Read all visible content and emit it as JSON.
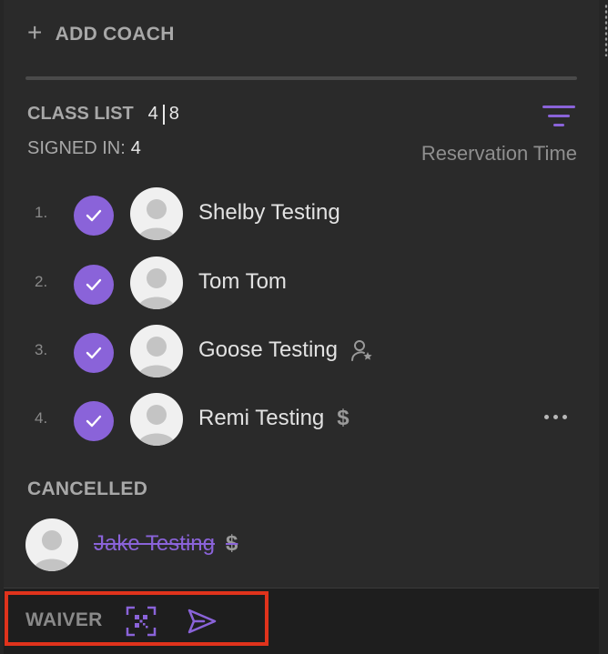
{
  "header": {
    "add_coach_label": "ADD COACH",
    "plus_symbol": "+"
  },
  "class_list": {
    "title": "CLASS LIST",
    "signed_in_count_a": "4",
    "capacity": "8",
    "signed_in_label": "SIGNED IN:",
    "signed_in_value": "4",
    "sort_label": "Reservation Time",
    "attendees": [
      {
        "index": "1.",
        "name": "Shelby Testing",
        "checked_in": true,
        "badge": ""
      },
      {
        "index": "2.",
        "name": "Tom Tom",
        "checked_in": true,
        "badge": ""
      },
      {
        "index": "3.",
        "name": "Goose Testing",
        "checked_in": true,
        "badge": "person-star-icon"
      },
      {
        "index": "4.",
        "name": "Remi Testing",
        "checked_in": true,
        "badge": "dollar-icon",
        "dollar": "$"
      }
    ]
  },
  "cancelled": {
    "title": "CANCELLED",
    "items": [
      {
        "name": "Jake Testing",
        "dollar": "$"
      }
    ]
  },
  "footer": {
    "waiver_label": "WAIVER"
  },
  "colors": {
    "accent": "#8a63d9",
    "highlight": "#e0331c",
    "background": "#2a2a2a"
  }
}
